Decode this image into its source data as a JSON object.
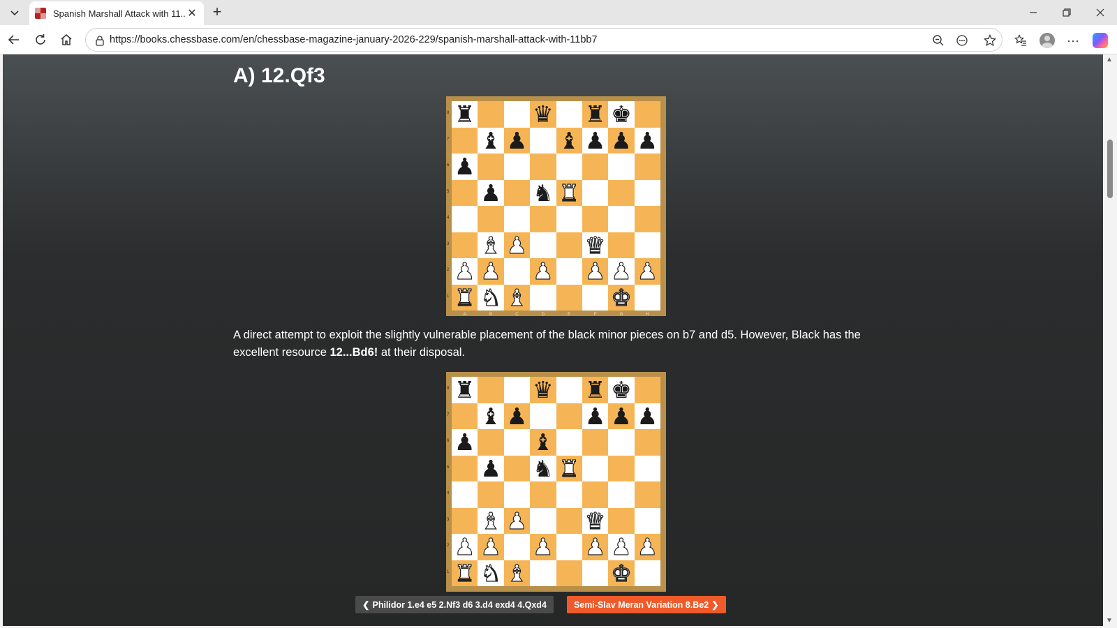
{
  "browser": {
    "tab_title": "Spanish Marshall Attack with 11...",
    "url": "https://books.chessbase.com/en/chessbase-magazine-january-2026-229/spanish-marshall-attack-with-11bb7"
  },
  "article": {
    "heading": "A) 12.Qf3",
    "paragraph_part1": "A direct attempt to exploit the slightly vulnerable placement of the black minor pieces on b7 and d5. However, Black has the excellent resource ",
    "paragraph_bold": "12...Bd6!",
    "paragraph_part2": " at their disposal."
  },
  "boards": [
    {
      "name": "diagram-1",
      "rows": [
        "r..q.rk.",
        ".bp.bppp",
        "p.......",
        ".p.nR...",
        "........",
        ".BP..Q..",
        "PP.P.PPP",
        "RNB...K."
      ]
    },
    {
      "name": "diagram-2",
      "rows": [
        "r..q.rk.",
        ".bp..ppp",
        "p..b....",
        ".p.nR...",
        "........",
        ".BP..Q..",
        "PP.P.PPP",
        "RNB...K."
      ]
    }
  ],
  "board_labels": {
    "files": [
      "A",
      "B",
      "C",
      "D",
      "E",
      "F",
      "G",
      "H"
    ],
    "ranks": [
      "8",
      "7",
      "6",
      "5",
      "4",
      "3",
      "2",
      "1"
    ]
  },
  "navigation": {
    "prev_label": "Philidor 1.e4 e5 2.Nf3 d6 3.d4 exd4 4.Qxd4",
    "next_label": "Semi-Slav Meran Variation 8.Be2"
  },
  "colors": {
    "light_square": "#ffffff",
    "dark_square": "#f5b556",
    "board_frame": "#b9904a",
    "next_button": "#ee5a2a",
    "prev_button": "#4a4a4a"
  }
}
